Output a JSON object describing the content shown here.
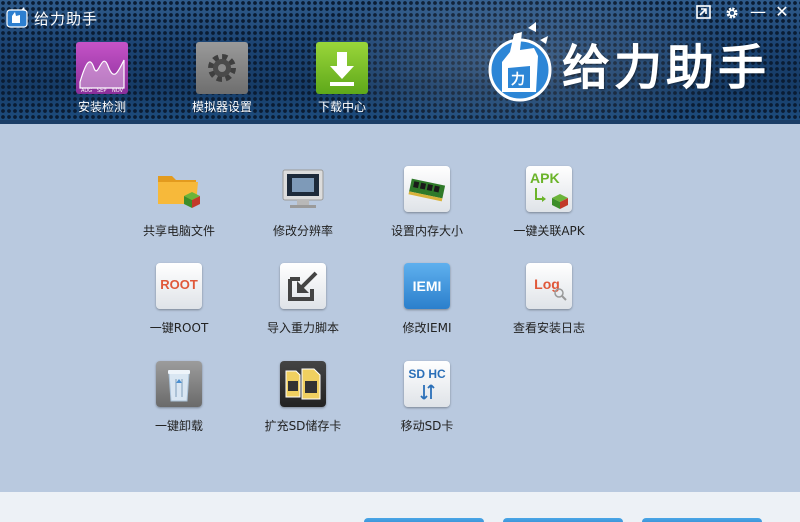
{
  "app": {
    "title": "给力助手",
    "brand": "给力助手"
  },
  "window_controls": [
    {
      "name": "restore-icon"
    },
    {
      "name": "settings-gear-icon"
    },
    {
      "name": "minimize-icon",
      "glyph": "—"
    },
    {
      "name": "close-icon",
      "glyph": "✕"
    }
  ],
  "toolbar": [
    {
      "label": "安装检测",
      "icon": "install-check-chart-icon",
      "chart_ticks": [
        "AUG",
        "SEP",
        "NOV"
      ]
    },
    {
      "label": "模拟器设置",
      "icon": "emulator-settings-gear-icon"
    },
    {
      "label": "下载中心",
      "icon": "download-arrow-icon"
    }
  ],
  "main": {
    "items": [
      {
        "label": "共享电脑文件",
        "icon": "folder-share-icon"
      },
      {
        "label": "修改分辨率",
        "icon": "monitor-resolution-icon"
      },
      {
        "label": "设置内存大小",
        "icon": "memory-chip-icon"
      },
      {
        "label": "一键关联APK",
        "icon": "apk-associate-icon",
        "icon_text": "APK"
      },
      {
        "label": "一键ROOT",
        "icon": "root-icon",
        "icon_text": "ROOT"
      },
      {
        "label": "导入重力脚本",
        "icon": "import-script-icon"
      },
      {
        "label": "修改IEMI",
        "icon": "iemi-icon",
        "icon_text": "IEMI"
      },
      {
        "label": "查看安装日志",
        "icon": "log-view-icon",
        "icon_text": "Log"
      },
      {
        "label": "一键卸载",
        "icon": "uninstall-trash-icon"
      },
      {
        "label": "扩充SD储存卡",
        "icon": "sd-card-expand-icon"
      },
      {
        "label": "移动SD卡",
        "icon": "sd-card-move-icon",
        "icon_text": "SD HC"
      }
    ]
  },
  "colors": {
    "header_bg": "#173a63",
    "main_bg": "#b9c9df",
    "footer_bg": "#edf1f6",
    "accent_blue": "#2a80c8"
  }
}
